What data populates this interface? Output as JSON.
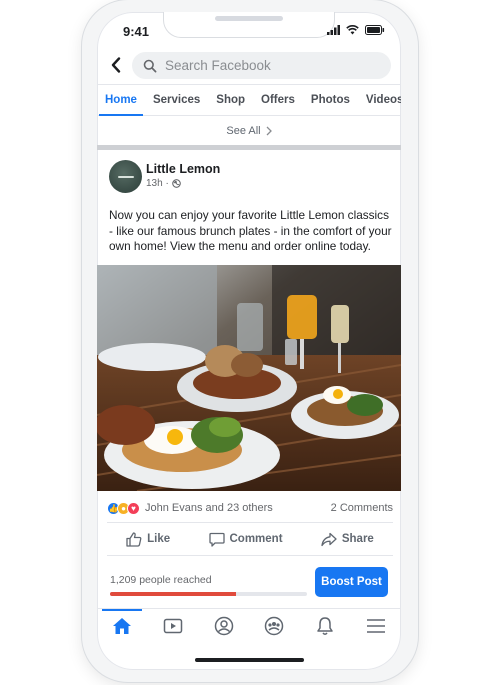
{
  "status_bar": {
    "time": "9:41"
  },
  "search": {
    "placeholder": "Search Facebook"
  },
  "tabs": [
    {
      "label": "Home",
      "active": true
    },
    {
      "label": "Services"
    },
    {
      "label": "Shop"
    },
    {
      "label": "Offers"
    },
    {
      "label": "Photos"
    },
    {
      "label": "Videos"
    }
  ],
  "see_all": "See All",
  "post": {
    "page_name": "Little Lemon",
    "time": "13h ·",
    "text": "Now you can enjoy your favorite Little Lemon classics -  like our famous brunch plates - in the comfort of your own home! View the menu and order online today.",
    "reactions": {
      "icons": [
        "like-reaction",
        "wow-reaction",
        "love-reaction"
      ],
      "reactors": "John Evans and 23 others",
      "comments": "2 Comments"
    },
    "actions": {
      "like": "Like",
      "comment": "Comment",
      "share": "Share"
    }
  },
  "reach": {
    "text": "1,209 people reached",
    "progress": 0.64
  },
  "boost": {
    "label": "Boost Post"
  },
  "bottom_nav": [
    "home-icon",
    "watch-icon",
    "profile-icon",
    "groups-icon",
    "notifications-icon",
    "menu-icon"
  ],
  "colors": {
    "accent": "#1877f2",
    "reach_bar": "#e04a3c"
  }
}
